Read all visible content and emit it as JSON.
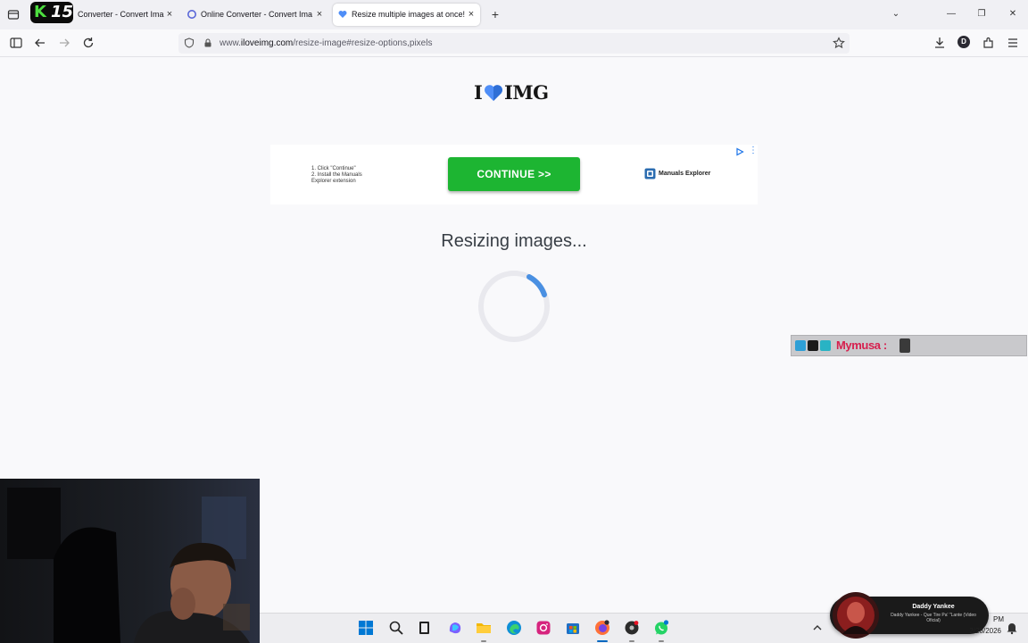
{
  "browser": {
    "overlay_badge": {
      "letter": "K",
      "number": "15"
    },
    "tabs": [
      {
        "title": "Converter - Convert Ima",
        "close": "×"
      },
      {
        "title": "Online Converter - Convert Ima",
        "close": "×"
      },
      {
        "title": "Resize multiple images at once!",
        "close": "×",
        "active": true
      }
    ],
    "new_tab": "+",
    "window_controls": {
      "list": "⌄",
      "minimize": "—",
      "restore": "❐",
      "close": "✕"
    },
    "url": {
      "prefix": "www.",
      "host": "iloveimg.com",
      "path": "/resize-image#resize-options,pixels"
    },
    "profile_initial": "D"
  },
  "page": {
    "logo": {
      "left": "I",
      "right": "IMG",
      "heart_color": "#4f8ef7"
    },
    "ad": {
      "steps": [
        "1. Click \"Continue\"",
        "2. Install the Manuals",
        "Explorer extension"
      ],
      "cta": "CONTINUE >>",
      "brand": "Manuals Explorer",
      "menu": "⋮",
      "cta_color": "#1db532"
    },
    "status_text": "Resizing images...",
    "spinner_color": "#4a90e2"
  },
  "overlay": {
    "mymusa_text": "Mymusa :"
  },
  "taskbar": {
    "icons": [
      "windows-start-icon",
      "search-icon",
      "task-view-icon",
      "copilot-icon",
      "file-explorer-icon",
      "edge-icon",
      "instagram-icon",
      "store-icon",
      "firefox-icon",
      "media-app-icon",
      "whatsapp-icon"
    ],
    "now_playing": {
      "title": "Daddy Yankee",
      "subtitle": "Daddy Yankee - Que Tire Pa' \"Lante (Video Oficial)"
    },
    "clock": {
      "time": "PM",
      "date": "2/28/2026"
    }
  }
}
